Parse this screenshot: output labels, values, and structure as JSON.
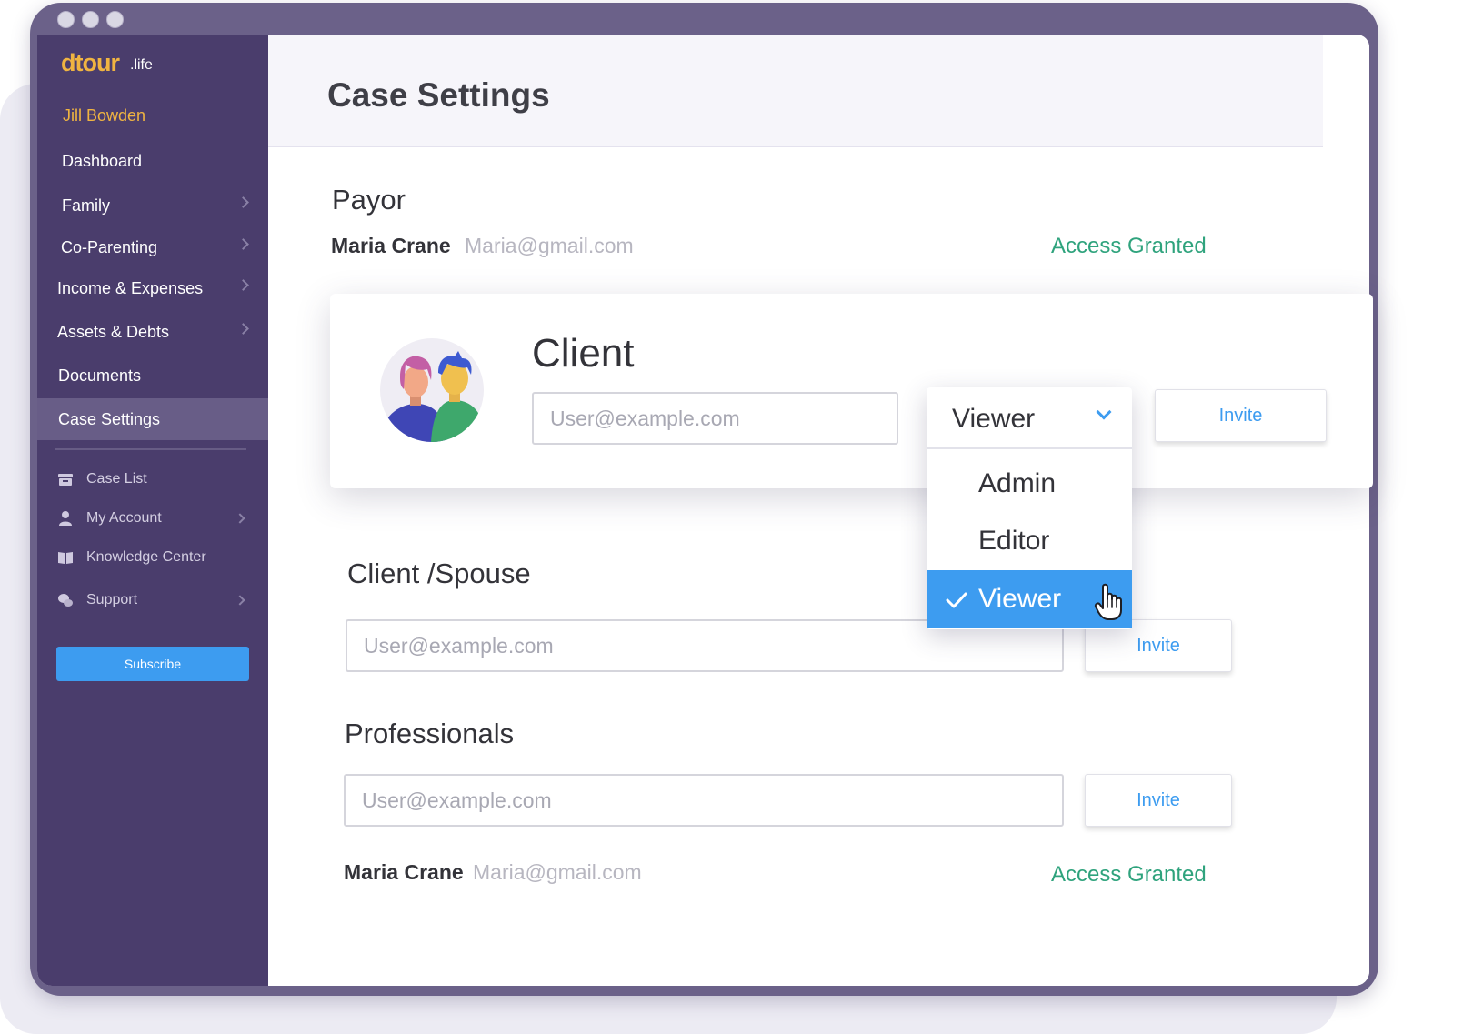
{
  "app": {
    "logo": "dtour",
    "logo_suffix": ".life",
    "user_name": "Jill Bowden"
  },
  "sidebar": {
    "nav": [
      {
        "label": "Dashboard",
        "has_chevron": false
      },
      {
        "label": "Family",
        "has_chevron": true
      },
      {
        "label": "Co-Parenting",
        "has_chevron": true
      },
      {
        "label": "Income & Expenses",
        "has_chevron": true
      },
      {
        "label": "Assets & Debts",
        "has_chevron": true
      },
      {
        "label": "Documents",
        "has_chevron": false
      },
      {
        "label": "Case Settings",
        "has_chevron": false,
        "active": true
      }
    ],
    "secondary": [
      {
        "label": "Case List",
        "icon": "archive-box-icon",
        "has_chevron": false
      },
      {
        "label": "My Account",
        "icon": "user-icon",
        "has_chevron": true
      },
      {
        "label": "Knowledge Center",
        "icon": "book-icon",
        "has_chevron": false
      },
      {
        "label": "Support",
        "icon": "chat-bubbles-icon",
        "has_chevron": true
      }
    ],
    "subscribe_label": "Subscribe"
  },
  "page": {
    "title": "Case Settings"
  },
  "payor": {
    "title": "Payor",
    "name": "Maria Crane",
    "email": "Maria@gmail.com",
    "status": "Access Granted"
  },
  "client": {
    "title": "Client",
    "email_placeholder": "User@example.com",
    "role_value": "Viewer",
    "role_options": [
      {
        "label": "Admin",
        "selected": false
      },
      {
        "label": "Editor",
        "selected": false
      },
      {
        "label": "Viewer",
        "selected": true
      }
    ],
    "invite_label": "Invite"
  },
  "client_spouse": {
    "title": "Client /Spouse",
    "email_placeholder": "User@example.com",
    "invite_label": "Invite"
  },
  "professionals": {
    "title": "Professionals",
    "email_placeholder": "User@example.com",
    "invite_label": "Invite",
    "name": "Maria Crane",
    "email": "Maria@gmail.com",
    "status": "Access Granted"
  },
  "colors": {
    "sidebar_bg": "#4a3d6c",
    "accent_blue": "#3d9cf0",
    "logo_gold": "#f0b441",
    "status_green": "#2fa37d"
  }
}
